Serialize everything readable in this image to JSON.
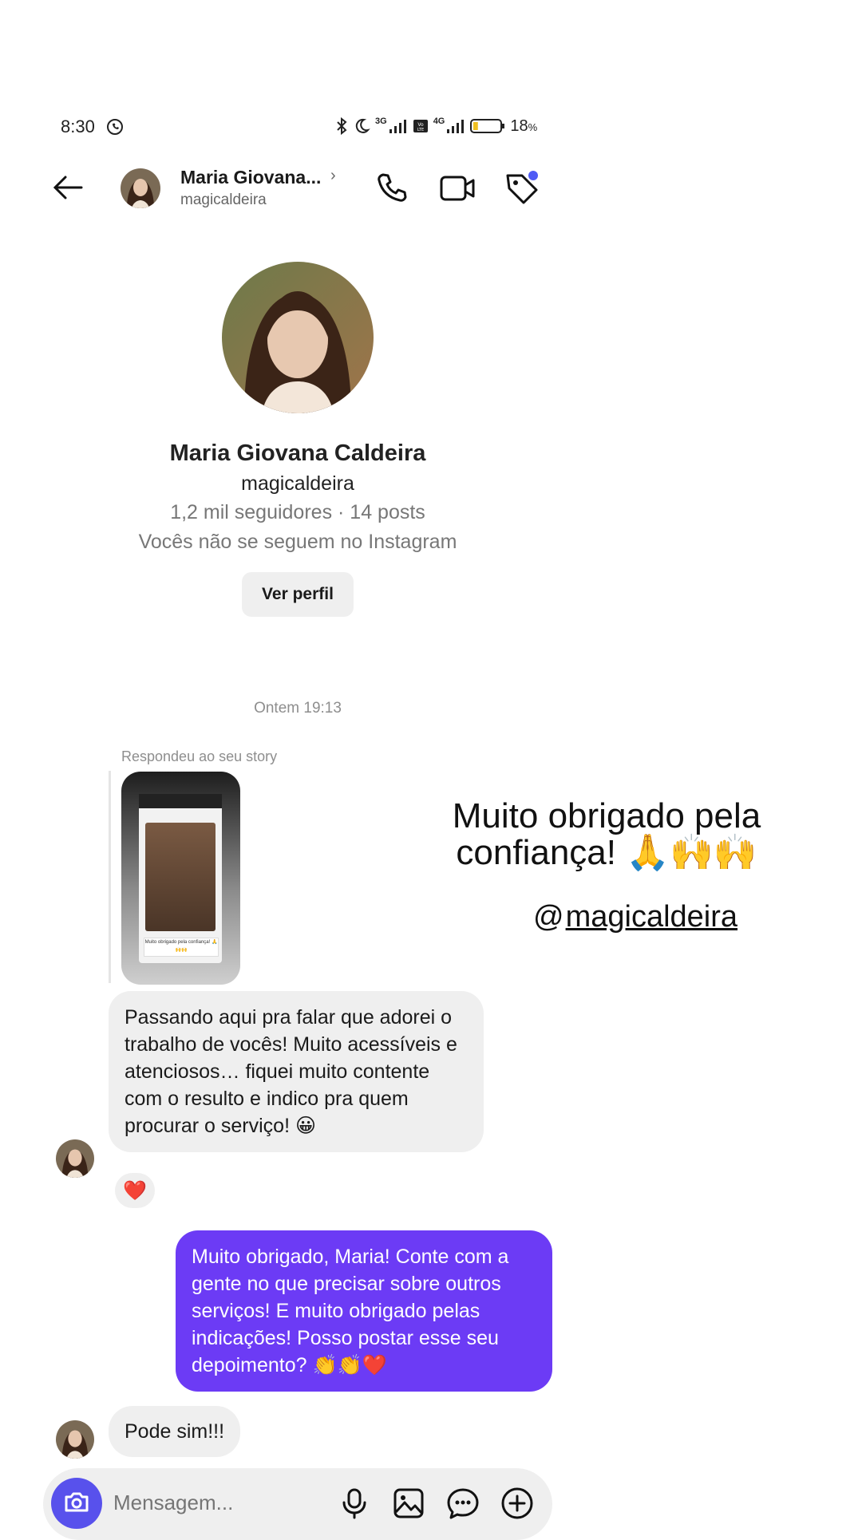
{
  "status_bar": {
    "time": "8:30",
    "net1": "3G",
    "net2": "4G",
    "battery": "18",
    "battery_unit": "%",
    "battery_level": 0.18
  },
  "header": {
    "name": "Maria Giovana...",
    "chevron": "›",
    "username": "magicaldeira",
    "icons": [
      "back-arrow-icon",
      "phone-icon",
      "video-camera-icon",
      "tag-icon"
    ],
    "tag_dot_color": "#4f5bf5"
  },
  "profile": {
    "full_name": "Maria Giovana Caldeira",
    "username": "magicaldeira",
    "stats": "1,2 mil seguidores · 14 posts",
    "follow_status": "Vocês não se seguem no Instagram",
    "view_profile_button": "Ver perfil"
  },
  "thread": {
    "date_separator": "Ontem 19:13",
    "story_reply_label": "Respondeu ao seu story",
    "story_caption_text": "Muito obrigado pela confiança! 🙏🙌🙌",
    "story_caption_line1": "Muito obrigado pela",
    "story_caption_line2": "confiança! 🙏🙌🙌",
    "story_mention": "magicaldeira",
    "story_mention_at": "@",
    "messages": [
      {
        "from": "them",
        "text": "Passando aqui pra falar que adorei o trabalho de vocês! Muito acessíveis e atenciosos… fiquei muito contente com o resulto e indico pra quem procurar o serviço! 😀",
        "reaction": "❤️"
      },
      {
        "from": "me",
        "text": "Muito obrigado, Maria! Conte com a gente no que precisar sobre outros serviços! E muito obrigado pelas indicações! Posso postar esse seu depoimento? 👏👏❤️"
      },
      {
        "from": "them",
        "text": "Pode sim!!!"
      }
    ]
  },
  "composer": {
    "placeholder": "Mensagem...",
    "icons": [
      "camera-icon",
      "microphone-icon",
      "gallery-icon",
      "sticker-icon",
      "plus-icon"
    ],
    "camera_color": "#5851ec"
  },
  "colors": {
    "outgoing_bubble": "#6c3bf5",
    "incoming_bubble": "#efefef"
  }
}
